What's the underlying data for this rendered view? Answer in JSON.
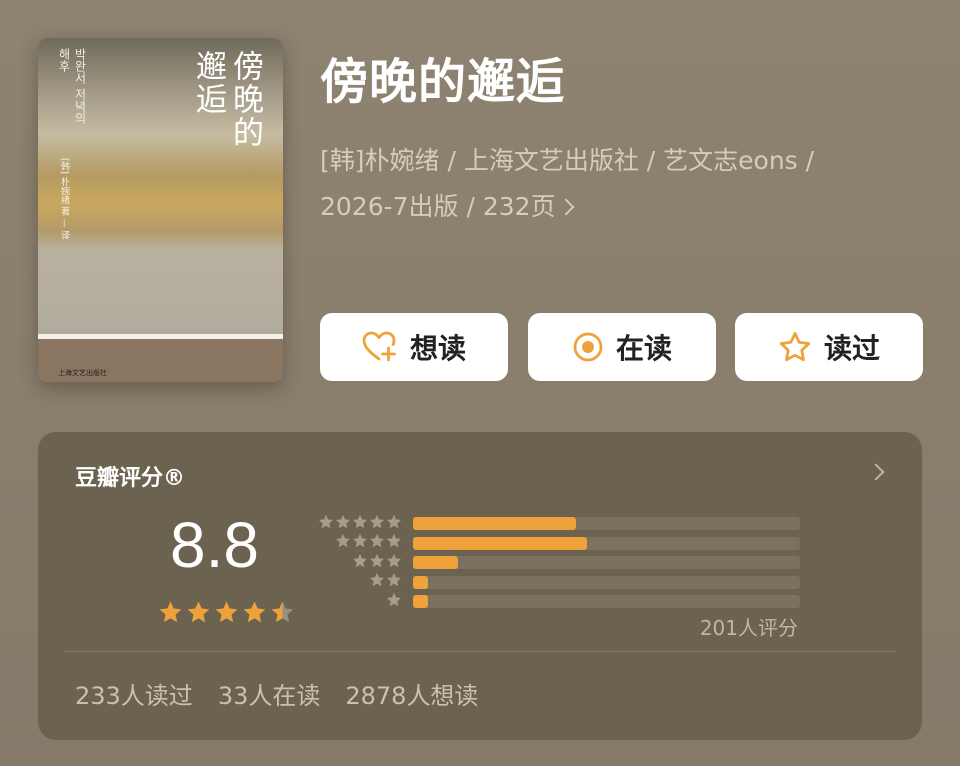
{
  "book": {
    "title": "傍晚的邂逅",
    "meta_line1": "[韩]朴婉绪 / 上海文艺出版社 / 艺文志eons /",
    "meta_line2": "2026-7出版 / 232页"
  },
  "cover": {
    "title": "傍晚的邂逅",
    "korean": "박완서 저녁의 해후",
    "meta": "[韩] 朴婉绪 著 — 译",
    "footer": "上海文艺出版社"
  },
  "actions": [
    {
      "label": "想读",
      "icon": "heart-plus-icon"
    },
    {
      "label": "在读",
      "icon": "target-circle-icon"
    },
    {
      "label": "读过",
      "icon": "star-outline-icon"
    }
  ],
  "rating": {
    "panel_title": "豆瓣评分®",
    "score": "8.8",
    "score_stars": 4.5,
    "rating_count": "201人评分",
    "distribution": [
      {
        "stars": 5,
        "fraction": 0.42
      },
      {
        "stars": 4,
        "fraction": 0.45
      },
      {
        "stars": 3,
        "fraction": 0.115
      },
      {
        "stars": 2,
        "fraction": 0.04
      },
      {
        "stars": 1,
        "fraction": 0.04
      }
    ],
    "stats": {
      "read": "233人读过",
      "reading": "33人在读",
      "want": "2878人想读"
    }
  },
  "colors": {
    "accent": "#f0a23a",
    "panel": "#6b6250",
    "background": "#8a7e6c"
  }
}
